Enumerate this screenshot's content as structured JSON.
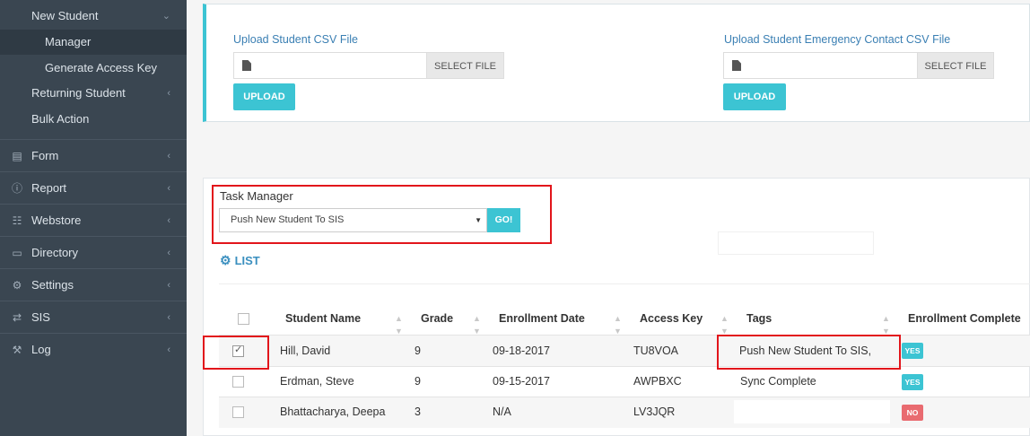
{
  "sidebar": {
    "subitems": [
      {
        "label": "New Student",
        "chevron": "⌄",
        "active": false
      },
      {
        "label": "Manager",
        "active": true
      },
      {
        "label": "Generate Access Key",
        "active": false
      },
      {
        "label": "Returning Student",
        "chevron": "‹",
        "active": false
      },
      {
        "label": "Bulk Action",
        "active": false
      }
    ],
    "items": [
      {
        "label": "Form",
        "icon": "file-icon",
        "chevron": "‹"
      },
      {
        "label": "Report",
        "icon": "info-icon",
        "chevron": "‹"
      },
      {
        "label": "Webstore",
        "icon": "cart-icon",
        "chevron": "‹"
      },
      {
        "label": "Directory",
        "icon": "folder-icon",
        "chevron": "‹"
      },
      {
        "label": "Settings",
        "icon": "gear-icon",
        "chevron": "‹"
      },
      {
        "label": "SIS",
        "icon": "exchange-icon",
        "chevron": "‹"
      },
      {
        "label": "Log",
        "icon": "wrench-icon",
        "chevron": "‹"
      }
    ]
  },
  "upload": {
    "student_csv": {
      "label": "Upload Student CSV File",
      "select_label": "SELECT FILE",
      "upload_label": "UPLOAD"
    },
    "emergency_csv": {
      "label": "Upload Student Emergency Contact CSV File",
      "select_label": "SELECT FILE",
      "upload_label": "UPLOAD"
    }
  },
  "task_manager": {
    "label": "Task Manager",
    "selected": "Push New Student To SIS",
    "go_label": "GO!"
  },
  "list": {
    "heading": "LIST",
    "columns": [
      "Student Name",
      "Grade",
      "Enrollment Date",
      "Access Key",
      "Tags",
      "Enrollment Complete"
    ],
    "rows": [
      {
        "checked": true,
        "name": "Hill, David",
        "grade": "9",
        "enrollment_date": "09-18-2017",
        "access_key": "TU8VOA",
        "tags": "Push New Student To SIS,",
        "complete": "YES"
      },
      {
        "checked": false,
        "name": "Erdman, Steve",
        "grade": "9",
        "enrollment_date": "09-15-2017",
        "access_key": "AWPBXC",
        "tags": "Sync Complete",
        "complete": "YES"
      },
      {
        "checked": false,
        "name": "Bhattacharya, Deepa",
        "grade": "3",
        "enrollment_date": "N/A",
        "access_key": "LV3JQR",
        "tags": "",
        "complete": "NO"
      }
    ]
  },
  "colors": {
    "accent": "#3cc4d3",
    "sidebar_bg": "#3a4651",
    "highlight": "#e2151b",
    "link": "#3a7fb3",
    "no_badge": "#e96b70"
  }
}
